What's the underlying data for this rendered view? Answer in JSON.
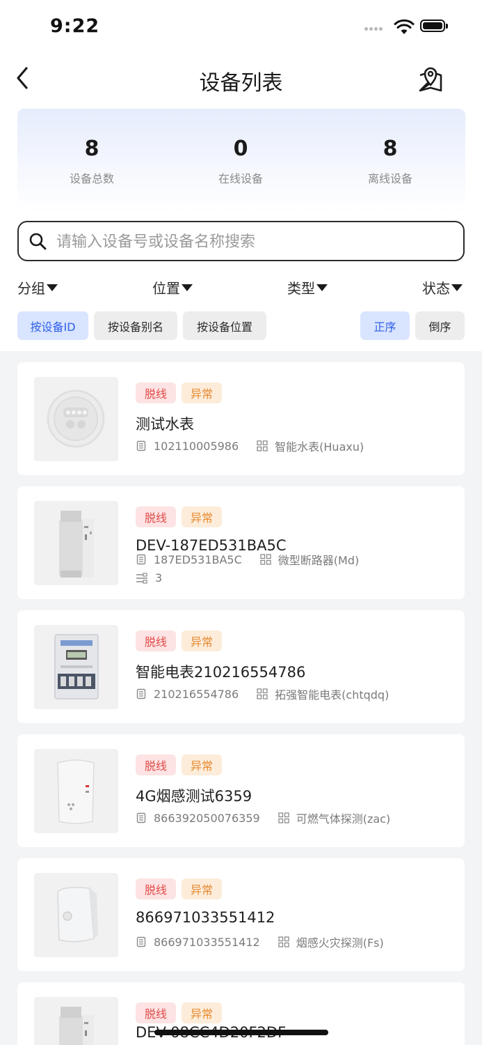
{
  "status_bar": {
    "time": "9:22"
  },
  "nav": {
    "title": "设备列表"
  },
  "stats": [
    {
      "value": "8",
      "label": "设备总数"
    },
    {
      "value": "0",
      "label": "在线设备"
    },
    {
      "value": "8",
      "label": "离线设备"
    }
  ],
  "search": {
    "placeholder": "请输入设备号或设备名称搜索"
  },
  "filters": [
    "分组",
    "位置",
    "类型",
    "状态"
  ],
  "sort_by": [
    "按设备ID",
    "按设备别名",
    "按设备位置"
  ],
  "order": [
    "正序",
    "倒序"
  ],
  "active_sort": "按设备ID",
  "active_order": "正序",
  "colors": {
    "accent": "#2e5fe8",
    "accent_bg": "#d9e4ff",
    "offline": "#e24a4a",
    "abnormal": "#e68a30"
  },
  "devices": [
    {
      "tags": [
        "脱线",
        "异常"
      ],
      "name": "测试水表",
      "id": "102110005986",
      "type": "智能水表(Huaxu)",
      "image": "water-meter"
    },
    {
      "tags": [
        "脱线",
        "异常"
      ],
      "name": "DEV-187ED531BA5C",
      "id": "187ED531BA5C",
      "type": "微型断路器(Md)",
      "channels": "3",
      "image": "circuit-breaker"
    },
    {
      "tags": [
        "脱线",
        "异常"
      ],
      "name": "智能电表210216554786",
      "id": "210216554786",
      "type": "拓强智能电表(chtqdq)",
      "image": "electric-meter"
    },
    {
      "tags": [
        "脱线",
        "异常"
      ],
      "name": "4G烟感测试6359",
      "id": "866392050076359",
      "type": "可燃气体探测(zac)",
      "image": "gas-detector"
    },
    {
      "tags": [
        "脱线",
        "异常"
      ],
      "name": "866971033551412",
      "id": "866971033551412",
      "type": "烟感火灾探测(Fs)",
      "image": "smoke-detector"
    },
    {
      "tags": [
        "脱线",
        "异常"
      ],
      "name": "DEV-08CC4D20F2DF",
      "image": "circuit-breaker"
    }
  ]
}
